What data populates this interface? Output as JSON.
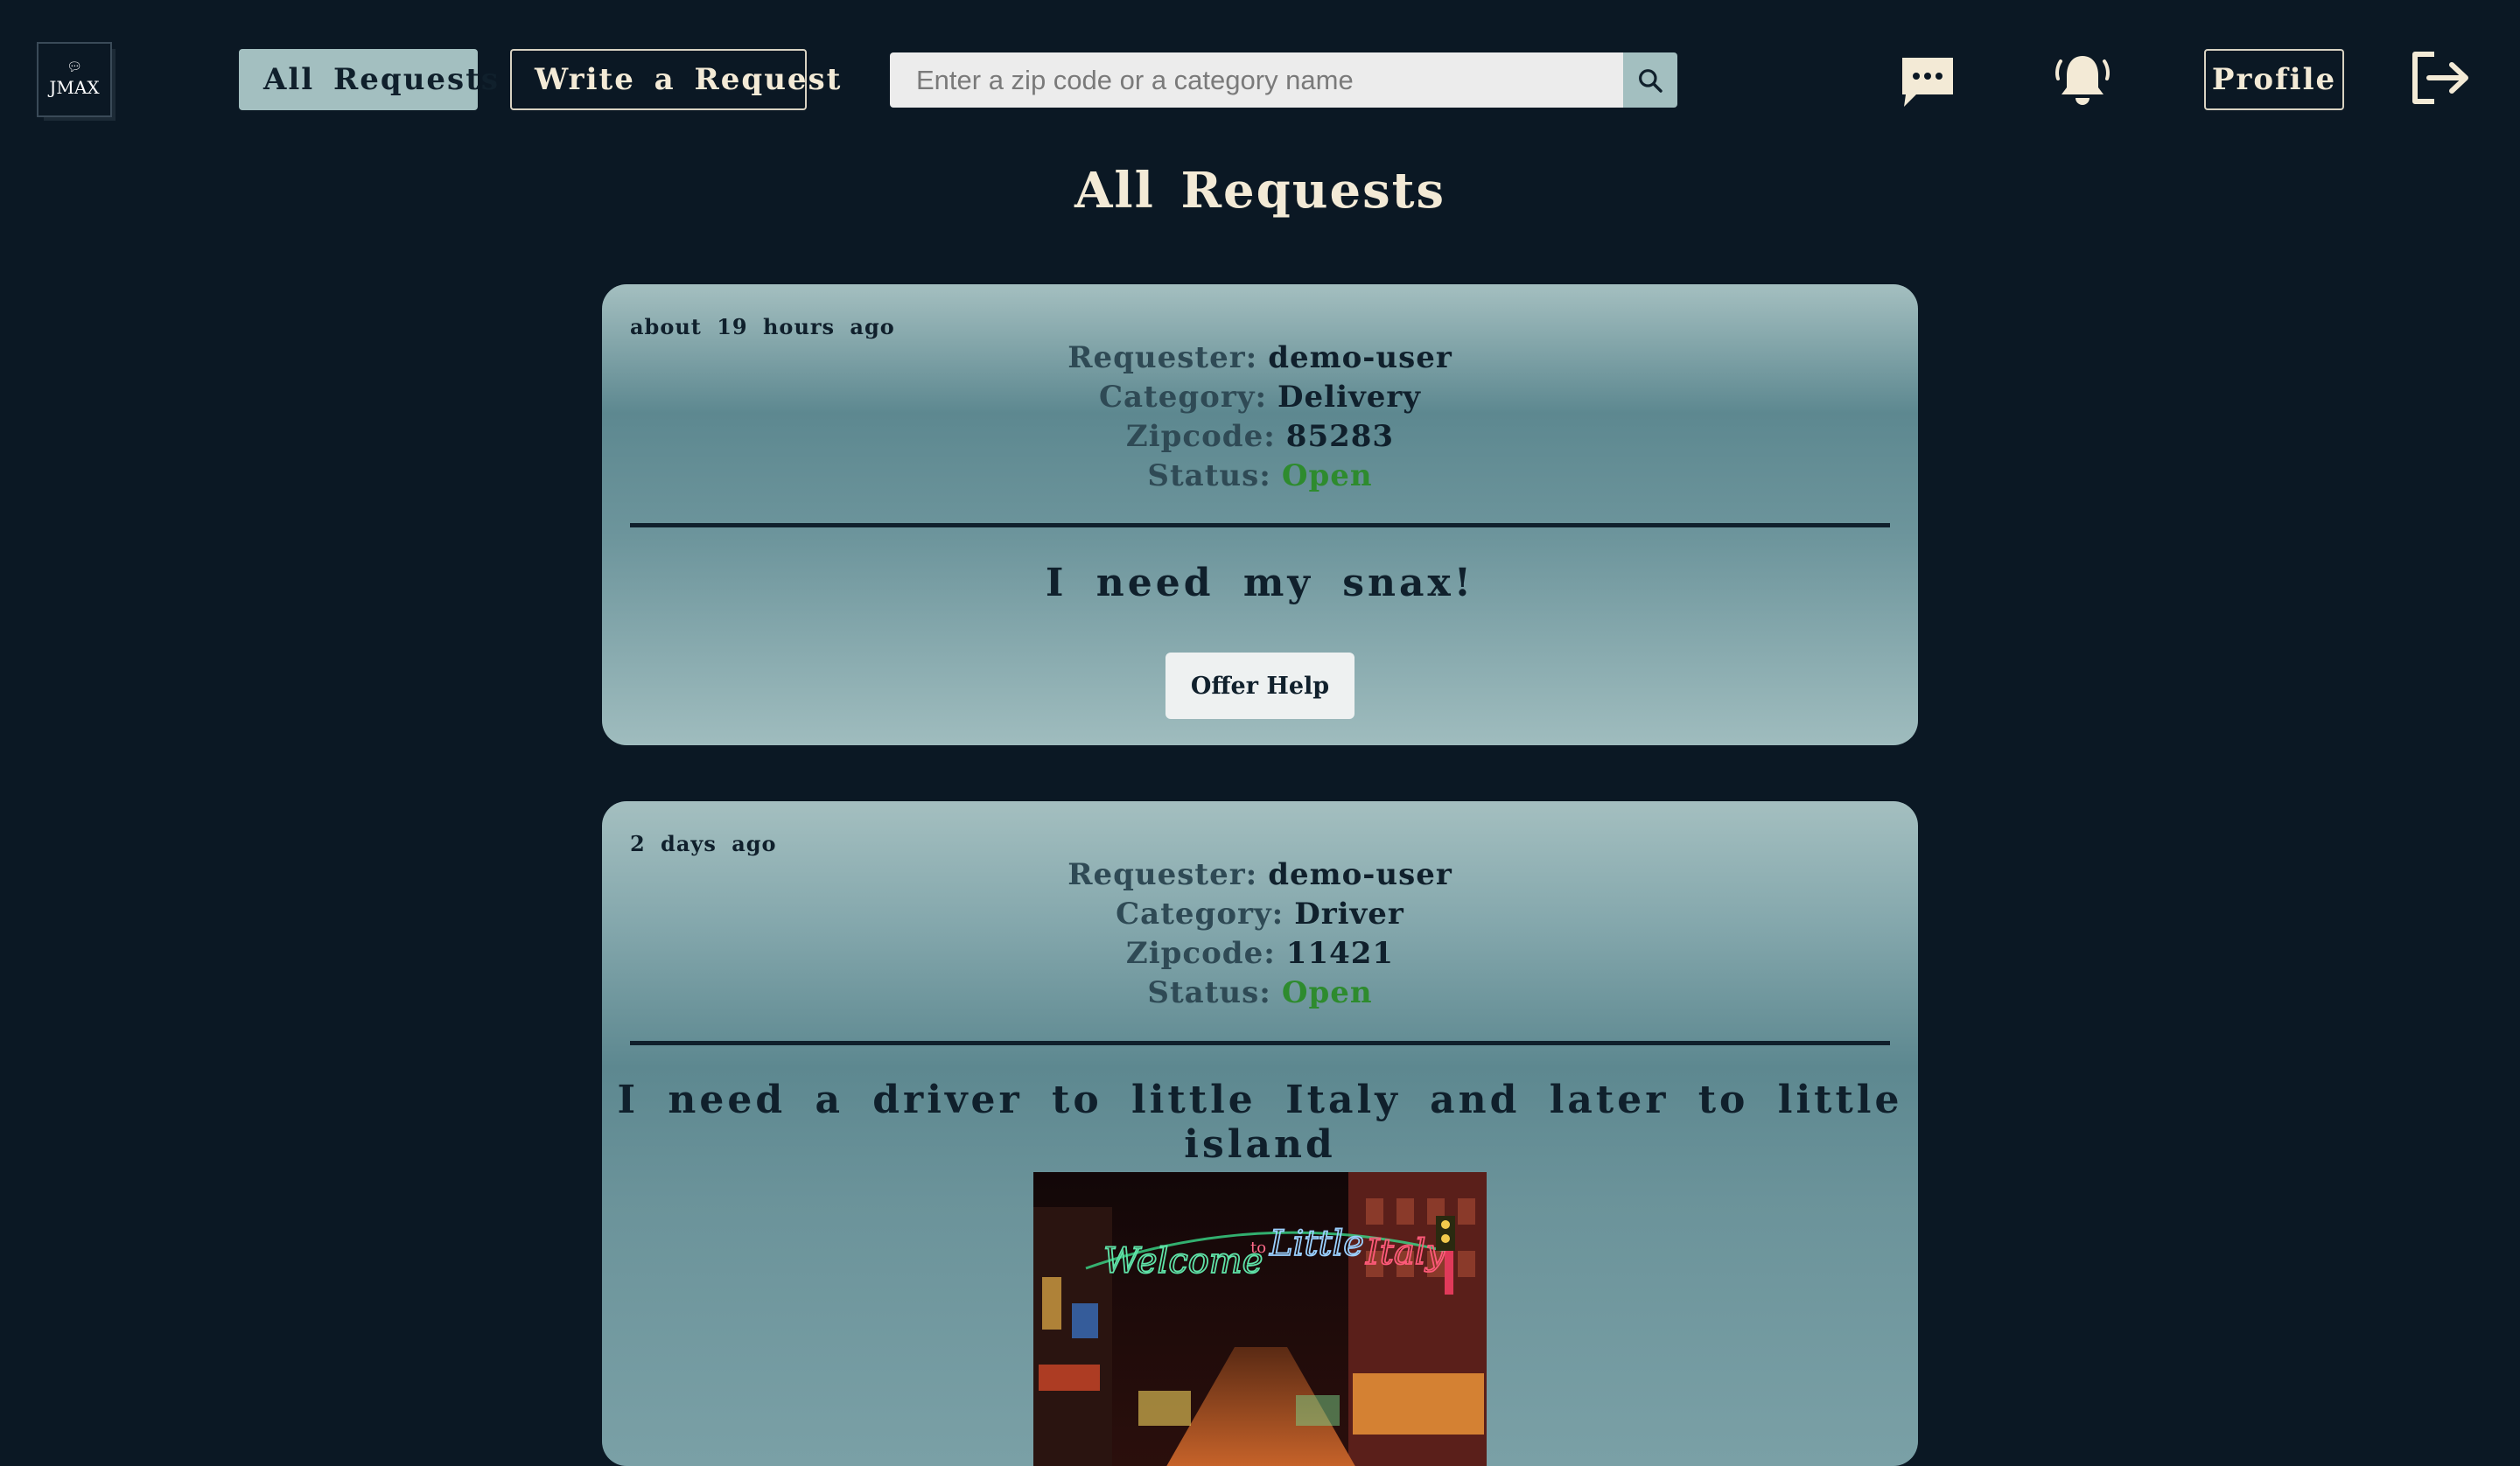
{
  "navbar": {
    "logo_text": "JMAX",
    "all_requests_label": "All Requests",
    "write_request_label": "Write a Request",
    "search_placeholder": "Enter a zip code or a category name",
    "profile_label": "Profile",
    "icons": [
      "chat-icon",
      "bell-icon",
      "logout-icon",
      "search-icon"
    ]
  },
  "page": {
    "title": "All Requests"
  },
  "labels": {
    "requester": "Requester:",
    "category": "Category:",
    "zipcode": "Zipcode:",
    "status": "Status:"
  },
  "requests": [
    {
      "timestamp": "about 19 hours ago",
      "requester": "demo-user",
      "category": "Delivery",
      "zipcode": "85283",
      "status": "Open",
      "title": "I need my snax!",
      "action_label": "Offer Help"
    },
    {
      "timestamp": "2 days ago",
      "requester": "demo-user",
      "category": "Driver",
      "zipcode": "11421",
      "status": "Open",
      "title": "I need a driver to little Italy and later to little island",
      "image_sign_text": "Welcome to Little Italy"
    }
  ],
  "colors": {
    "background": "#0b1824",
    "accent": "#a3bfc0",
    "status_open": "#2e8b2e",
    "text_light": "#f3ead6"
  }
}
